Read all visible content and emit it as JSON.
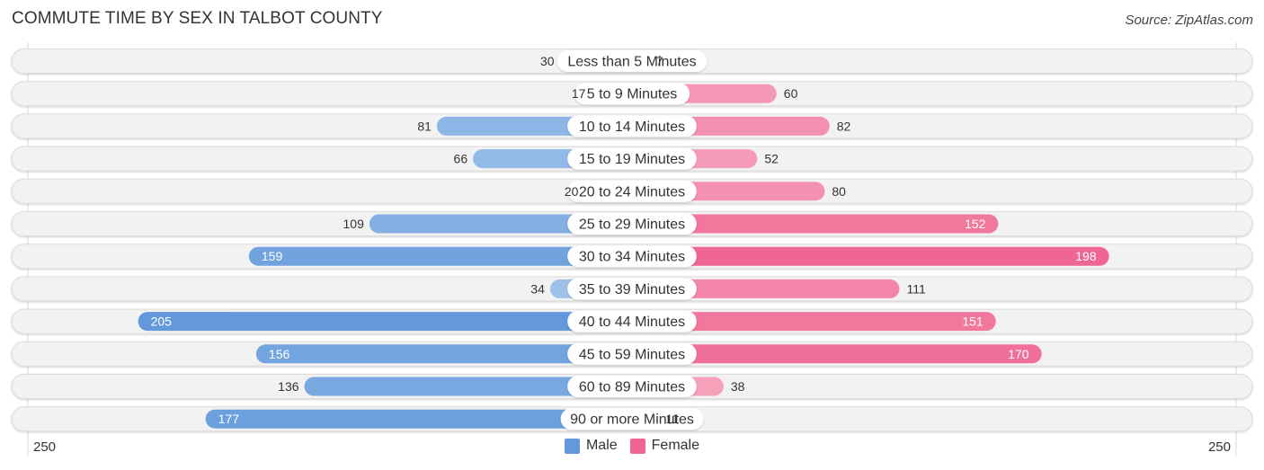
{
  "header": {
    "title": "COMMUTE TIME BY SEX IN TALBOT COUNTY",
    "source": "Source: ZipAtlas.com"
  },
  "colors": {
    "male_light": "#a9c9ec",
    "male_strong": "#6399dc",
    "female_light": "#f7aec4",
    "female_strong": "#f06591",
    "track": "#f2f2f2",
    "track_border": "#dcdcdc"
  },
  "chart_data": {
    "type": "bar",
    "orientation": "horizontal-diverging",
    "title": "COMMUTE TIME BY SEX IN TALBOT COUNTY",
    "categories": [
      "Less than 5 Minutes",
      "5 to 9 Minutes",
      "10 to 14 Minutes",
      "15 to 19 Minutes",
      "20 to 24 Minutes",
      "25 to 29 Minutes",
      "30 to 34 Minutes",
      "35 to 39 Minutes",
      "40 to 44 Minutes",
      "45 to 59 Minutes",
      "60 to 89 Minutes",
      "90 or more Minutes"
    ],
    "series": [
      {
        "name": "Male",
        "side": "left",
        "values": [
          30,
          17,
          81,
          66,
          20,
          109,
          159,
          34,
          205,
          156,
          136,
          177
        ]
      },
      {
        "name": "Female",
        "side": "right",
        "values": [
          7,
          60,
          82,
          52,
          80,
          152,
          198,
          111,
          151,
          170,
          38,
          11
        ]
      }
    ],
    "xlim": [
      250,
      250
    ],
    "axis_labels": {
      "left": "250",
      "right": "250"
    },
    "legend": {
      "position": "bottom-center",
      "entries": [
        "Male",
        "Female"
      ]
    },
    "grid": false
  }
}
